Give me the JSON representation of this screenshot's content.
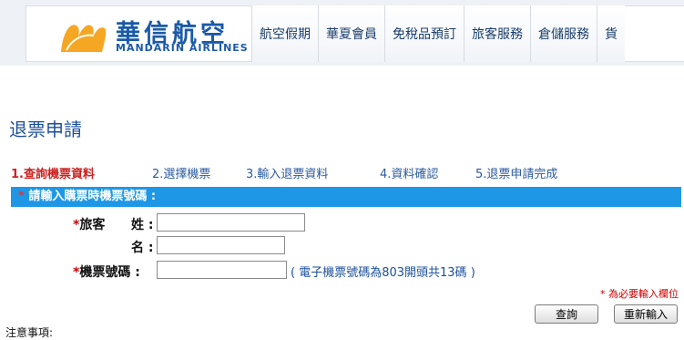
{
  "header": {
    "logo_zh": "華信航空",
    "logo_en": "MANDARIN AIRLINES",
    "nav": [
      "航空假期",
      "華夏會員",
      "免稅品預訂",
      "旅客服務",
      "倉儲服務",
      "貨"
    ]
  },
  "page_title": "退票申請",
  "steps": [
    "1.查詢機票資料",
    "2.選擇機票",
    "3.輸入退票資料",
    "4.資料確認",
    "5.退票申請完成"
  ],
  "form": {
    "bar_label": "請輸入購票時機票號碼 :",
    "required_mark": "*",
    "passenger_label": "旅客",
    "surname_label": "姓 :",
    "given_label": "名 :",
    "ticket_label": "機票號碼 :",
    "ticket_hint": "( 電子機票號碼為803開頭共13碼 )",
    "surname_value": "",
    "given_value": "",
    "ticket_value": "",
    "required_note": "* 為必要輸入欄位"
  },
  "buttons": {
    "query": "查詢",
    "reset": "重新輸入"
  },
  "notes_label": "注意事項:",
  "colors": {
    "brand": "#1b5aa8",
    "bar": "#1e98e6",
    "required": "#cc0000",
    "active_step": "#cc2222"
  }
}
